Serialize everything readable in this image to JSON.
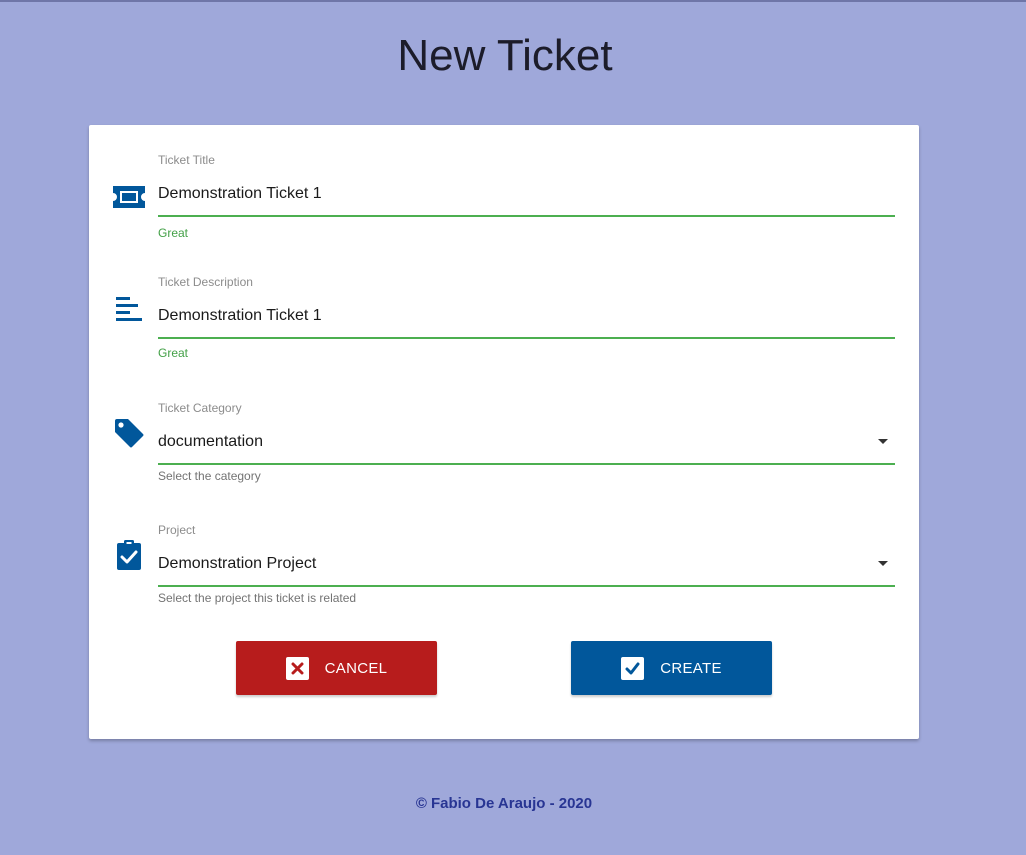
{
  "page": {
    "title": "New Ticket",
    "colors": {
      "background": "#9fa8da",
      "accent": "#01579b",
      "success": "#4caf50",
      "danger": "#b71c1c"
    }
  },
  "form": {
    "fields": [
      {
        "icon": "ticket-icon",
        "label": "Ticket Title",
        "value": "Demonstration Ticket 1",
        "hint": "Great",
        "hint_status": "success"
      },
      {
        "icon": "description-lines-icon",
        "label": "Ticket Description",
        "value": "Demonstration Ticket 1",
        "hint": "Great",
        "hint_status": "success"
      },
      {
        "icon": "tag-icon",
        "label": "Ticket Category",
        "value": "documentation",
        "hint": "Select the category",
        "hint_status": "info"
      },
      {
        "icon": "clipboard-check-icon",
        "label": "Project",
        "value": "Demonstration Project",
        "hint": "Select the project this ticket is related",
        "hint_status": "info"
      }
    ],
    "buttons": {
      "cancel": {
        "label": "CANCEL",
        "icon": "close-box-icon"
      },
      "create": {
        "label": "CREATE",
        "icon": "check-box-icon"
      }
    }
  },
  "footer": {
    "copyright_symbol": "©",
    "text": "Fabio De Araujo - 2020"
  }
}
